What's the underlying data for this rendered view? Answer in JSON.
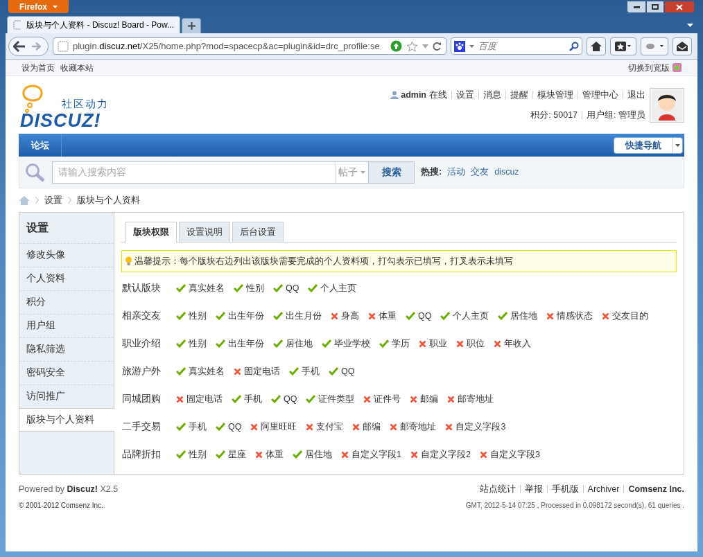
{
  "browser": {
    "menu_button": "Firefox",
    "tab_title": "版块与个人资料 - Discuz! Board - Pow...",
    "url_prefix": "plugin.",
    "url_domain": "discuz.net",
    "url_path": "/X25/home.php?mod=spacecp&ac=plugin&id=drc_profile:se",
    "search_placeholder": "百度"
  },
  "topbar": {
    "links": [
      "设为首页",
      "收藏本站"
    ],
    "switch": "切换到宽版"
  },
  "header": {
    "logo_tagline": "社区动力",
    "logo_text": "DISCUZ!",
    "username": "admin",
    "status": "在线",
    "links": [
      "设置",
      "消息",
      "提醒",
      "模块管理",
      "管理中心",
      "退出"
    ],
    "credits": "积分: 50017",
    "group": "用户组: 管理员"
  },
  "nav": {
    "items": [
      {
        "label": "论坛",
        "selected": true
      }
    ],
    "quick_nav": "快捷导航"
  },
  "search": {
    "placeholder": "请输入搜索内容",
    "scope": "帖子",
    "button": "搜索",
    "hot_label": "热搜:",
    "hot": [
      "活动",
      "交友",
      "discuz"
    ]
  },
  "breadcrumb": [
    "设置",
    "版块与个人资料"
  ],
  "sidebar": {
    "title": "设置",
    "items": [
      {
        "label": "修改头像",
        "selected": false
      },
      {
        "label": "个人资料",
        "selected": false
      },
      {
        "label": "积分",
        "selected": false
      },
      {
        "label": "用户组",
        "selected": false
      },
      {
        "label": "隐私筛选",
        "selected": false
      },
      {
        "label": "密码安全",
        "selected": false
      },
      {
        "label": "访问推广",
        "selected": false
      },
      {
        "label": "版块与个人资料",
        "selected": true
      }
    ]
  },
  "tabs": [
    {
      "label": "版块权限",
      "selected": true
    },
    {
      "label": "设置说明",
      "selected": false
    },
    {
      "label": "后台设置",
      "selected": false
    }
  ],
  "tip": "温馨提示：每个版块右边列出该版块需要完成的个人资料项，打勾表示已填写，打叉表示未填写",
  "sections": [
    {
      "name": "默认版块",
      "fields": [
        {
          "label": "真实姓名",
          "filled": true
        },
        {
          "label": "性别",
          "filled": true
        },
        {
          "label": "QQ",
          "filled": true
        },
        {
          "label": "个人主页",
          "filled": true
        }
      ]
    },
    {
      "name": "相亲交友",
      "fields": [
        {
          "label": "性别",
          "filled": true
        },
        {
          "label": "出生年份",
          "filled": true
        },
        {
          "label": "出生月份",
          "filled": true
        },
        {
          "label": "身高",
          "filled": false
        },
        {
          "label": "体重",
          "filled": false
        },
        {
          "label": "QQ",
          "filled": true
        },
        {
          "label": "个人主页",
          "filled": true
        },
        {
          "label": "居住地",
          "filled": true
        },
        {
          "label": "情感状态",
          "filled": false
        },
        {
          "label": "交友目的",
          "filled": false
        }
      ]
    },
    {
      "name": "职业介绍",
      "fields": [
        {
          "label": "性别",
          "filled": true
        },
        {
          "label": "出生年份",
          "filled": true
        },
        {
          "label": "居住地",
          "filled": true
        },
        {
          "label": "毕业学校",
          "filled": true
        },
        {
          "label": "学历",
          "filled": true
        },
        {
          "label": "职业",
          "filled": false
        },
        {
          "label": "职位",
          "filled": false
        },
        {
          "label": "年收入",
          "filled": false
        }
      ]
    },
    {
      "name": "旅游户外",
      "fields": [
        {
          "label": "真实姓名",
          "filled": true
        },
        {
          "label": "固定电话",
          "filled": false
        },
        {
          "label": "手机",
          "filled": true
        },
        {
          "label": "QQ",
          "filled": true
        }
      ]
    },
    {
      "name": "同城团购",
      "fields": [
        {
          "label": "固定电话",
          "filled": false
        },
        {
          "label": "手机",
          "filled": true
        },
        {
          "label": "QQ",
          "filled": true
        },
        {
          "label": "证件类型",
          "filled": true
        },
        {
          "label": "证件号",
          "filled": false
        },
        {
          "label": "邮编",
          "filled": false
        },
        {
          "label": "邮寄地址",
          "filled": false
        }
      ]
    },
    {
      "name": "二手交易",
      "fields": [
        {
          "label": "手机",
          "filled": true
        },
        {
          "label": "QQ",
          "filled": true
        },
        {
          "label": "阿里旺旺",
          "filled": false
        },
        {
          "label": "支付宝",
          "filled": false
        },
        {
          "label": "邮编",
          "filled": false
        },
        {
          "label": "邮寄地址",
          "filled": false
        },
        {
          "label": "自定义字段3",
          "filled": false
        }
      ]
    },
    {
      "name": "品牌折扣",
      "fields": [
        {
          "label": "性别",
          "filled": true
        },
        {
          "label": "星座",
          "filled": true
        },
        {
          "label": "体重",
          "filled": false
        },
        {
          "label": "居住地",
          "filled": true
        },
        {
          "label": "自定义字段1",
          "filled": false
        },
        {
          "label": "自定义字段2",
          "filled": false
        },
        {
          "label": "自定义字段3",
          "filled": false
        }
      ]
    }
  ],
  "footer": {
    "powered_prefix": "Powered by",
    "powered_brand": "Discuz!",
    "powered_version": "X2.5",
    "copyright": "© 2001-2012 Comsenz Inc.",
    "links": [
      "站点统计",
      "举报",
      "手机版",
      "Archiver"
    ],
    "company": "Comsenz Inc.",
    "stats": "GMT, 2012-5-14 07:25 , Processed in 0.098172 second(s), 61 queries ."
  }
}
